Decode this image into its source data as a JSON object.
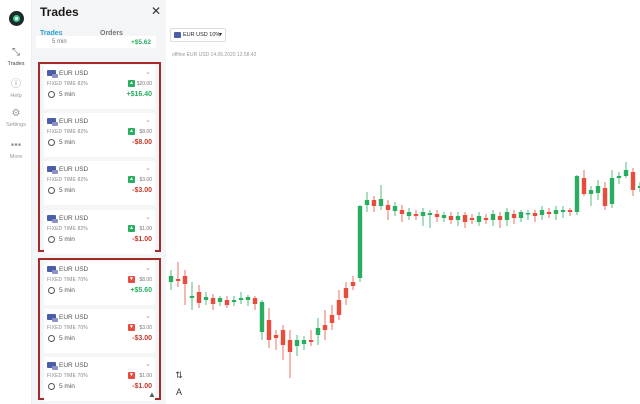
{
  "rail": {
    "items": [
      {
        "label": "Trades",
        "icon": "arrows-icon"
      },
      {
        "label": "Help",
        "icon": "help-icon"
      },
      {
        "label": "Settings",
        "icon": "gear-icon"
      },
      {
        "label": "More",
        "icon": "more-icon"
      }
    ]
  },
  "panel": {
    "title": "Trades",
    "close_glyph": "✕",
    "tabs": [
      {
        "label": "Trades"
      },
      {
        "label": "Orders"
      }
    ],
    "partial_card": {
      "duration": "5 min",
      "pnl": "+$5.62"
    }
  },
  "cards": [
    {
      "pair": "EUR USD",
      "type": "FIXED TIME 82%",
      "direction": "up",
      "amount": "$20.00",
      "duration": "5 min",
      "pnl": "+$16.40",
      "pnl_sign": "pos"
    },
    {
      "pair": "EUR USD",
      "type": "FIXED TIME 82%",
      "direction": "up",
      "amount": "$8.00",
      "duration": "5 min",
      "pnl": "-$8.00",
      "pnl_sign": "neg"
    },
    {
      "pair": "EUR USD",
      "type": "FIXED TIME 82%",
      "direction": "up",
      "amount": "$3.00",
      "duration": "5 min",
      "pnl": "-$3.00",
      "pnl_sign": "neg"
    },
    {
      "pair": "EUR USD",
      "type": "FIXED TIME 82%",
      "direction": "up",
      "amount": "$1.00",
      "duration": "5 min",
      "pnl": "-$1.00",
      "pnl_sign": "neg"
    },
    {
      "pair": "EUR USD",
      "type": "FIXED TIME 70%",
      "direction": "down",
      "amount": "$8.00",
      "duration": "5 min",
      "pnl": "+$5.60",
      "pnl_sign": "pos"
    },
    {
      "pair": "EUR USD",
      "type": "FIXED TIME 70%",
      "direction": "down",
      "amount": "$3.00",
      "duration": "5 min",
      "pnl": "-$3.00",
      "pnl_sign": "neg"
    },
    {
      "pair": "EUR USD",
      "type": "FIXED TIME 70%",
      "direction": "down",
      "amount": "$1.00",
      "duration": "5 min",
      "pnl": "-$1.00",
      "pnl_sign": "neg"
    }
  ],
  "chart": {
    "asset": "EUR USD 10%",
    "offline_note": "offline EUR USD 14.06.2020 12:58:42",
    "up_color": "#27ae60",
    "down_color": "#e74c3c"
  }
}
